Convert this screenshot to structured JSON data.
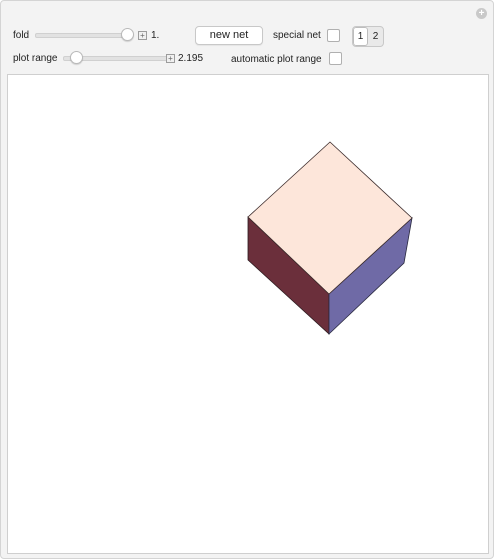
{
  "controls": {
    "fold": {
      "label": "fold",
      "value_text": "1.",
      "value": 1.0,
      "min": 0,
      "max": 1
    },
    "plot_range": {
      "label": "plot range",
      "value_text": "2.195",
      "fraction": 0.09
    },
    "new_net_label": "new net",
    "special_net": {
      "label": "special net",
      "checked": false
    },
    "net_choice": {
      "options": [
        "1",
        "2"
      ],
      "selected": "1"
    },
    "automatic_plot_range": {
      "label": "automatic plot range",
      "checked": false
    }
  },
  "plot": {
    "faces": [
      {
        "name": "top",
        "color": "#fde6da"
      },
      {
        "name": "left",
        "color": "#6b2f3b"
      },
      {
        "name": "right",
        "color": "#6f6aa6"
      }
    ]
  },
  "colors": {
    "background": "#f3f3f3",
    "plot_background": "#ffffff"
  },
  "icons": {
    "add": "plus-circle-icon",
    "stepper": "plus-icon"
  }
}
